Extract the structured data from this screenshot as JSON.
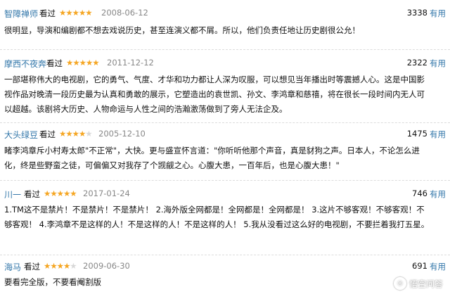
{
  "reviews": [
    {
      "name": "智障禅师",
      "watched": "看过",
      "stars": 5,
      "date": "2008-06-12",
      "votes": "3338",
      "useful": "有用",
      "text": "很明显，导演和编剧都不想去戏说历史，甚至连演义都不屑。所以，他们负责任地让历史剧很公允！"
    },
    {
      "name": "摩西不夜奔",
      "watched": "看过",
      "stars": 5,
      "date": "2011-12-12",
      "votes": "2322",
      "useful": "有用",
      "text": "一部堪称伟大的电视剧，它的勇气、气度、才华和功力都让人深为叹服，可以想见当年播出时等震撼人心。这是中国影视作品对晚清一段历史最为认真和勇敢的展示，它塑造出的袁世凯、孙文、李鸿章和慈禧，将在很长一段时间内无人可以超越。该剧将大历史、人物命运与人性之间的浩瀚激荡做到了旁人无法企及。"
    },
    {
      "name": "大头绿豆",
      "watched": "看过",
      "stars": 4,
      "date": "2005-12-10",
      "votes": "1475",
      "useful": "有用",
      "text": "睹李鸿章斥小村寿太郎\"不正常\"，大快。更与盛宣怀言道：\"你听听他那个声音，真是豺狗之声。日本人，不论怎么进化，终是些野蛮之徒，可偏偏又对我存了个觊觎之心。心腹大患，一百年后，也是心腹大患！\""
    },
    {
      "name": "川一",
      "watched": "看过",
      "stars": 5,
      "date": "2017-01-24",
      "votes": "746",
      "useful": "有用",
      "text": "1.TM这不是禁片！不是禁片！不是禁片！ 2.海外版全网都是！全网都是！全网都是！ 3.这片不够客观！不够客观！不够客观！ 4.李鸿章不是这样的人！不是这样的人！不是这样的人！ 5.我从没看过这么好的电视剧，不要拦着我打五星。"
    },
    {
      "name": "海马",
      "watched": "看过",
      "stars": 4,
      "date": "2009-06-30",
      "votes": "691",
      "useful": "有用",
      "text": "要看完全版，不要看阉割版"
    }
  ],
  "watermark": {
    "logo": "◎",
    "text": "悟空问答"
  }
}
